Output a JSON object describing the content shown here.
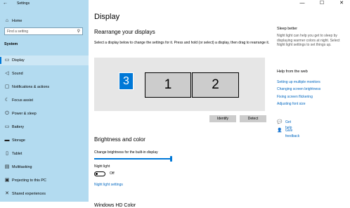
{
  "window": {
    "title": "Settings",
    "back_glyph": "←",
    "controls": {
      "minimize": "—",
      "maximize": "☐",
      "close": "✕"
    }
  },
  "sidebar": {
    "home_label": "Home",
    "search_placeholder": "Find a setting",
    "section_title": "System",
    "items": [
      {
        "label": "Display",
        "icon": "monitor-icon",
        "selected": true
      },
      {
        "label": "Sound",
        "icon": "speaker-icon"
      },
      {
        "label": "Notifications & actions",
        "icon": "notification-icon"
      },
      {
        "label": "Focus assist",
        "icon": "moon-icon"
      },
      {
        "label": "Power & sleep",
        "icon": "power-icon"
      },
      {
        "label": "Battery",
        "icon": "battery-icon"
      },
      {
        "label": "Storage",
        "icon": "storage-icon"
      },
      {
        "label": "Tablet",
        "icon": "tablet-icon"
      },
      {
        "label": "Multitasking",
        "icon": "multitasking-icon"
      },
      {
        "label": "Projecting to this PC",
        "icon": "projecting-icon"
      },
      {
        "label": "Shared experiences",
        "icon": "shared-icon"
      }
    ]
  },
  "main": {
    "title": "Display",
    "rearrange": {
      "heading": "Rearrange your displays",
      "description": "Select a display below to change the settings for it. Press and hold (or select) a display, then drag to rearrange it.",
      "monitors": [
        {
          "number": "3",
          "selected": true
        },
        {
          "number": "1",
          "selected": false
        },
        {
          "number": "2",
          "selected": false
        }
      ],
      "identify_label": "Identify",
      "detect_label": "Detect"
    },
    "brightness": {
      "heading": "Brightness and color",
      "slider_label": "Change brightness for the built-in display",
      "level_percent": 100
    },
    "night_light": {
      "label": "Night light",
      "state": "Off",
      "settings_link": "Night light settings"
    },
    "next_heading": "Windows HD Color"
  },
  "right_panel": {
    "sleep_title": "Sleep better",
    "sleep_text": "Night light can help you get to sleep by displaying warmer colors at night. Select Night light settings to set things up.",
    "help_title": "Help from the web",
    "help_links": [
      "Setting up multiple monitors",
      "Changing screen brightness",
      "Fixing screen flickering",
      "Adjusting font size"
    ],
    "get_help": "Get help",
    "give_feedback": "Give feedback"
  },
  "colors": {
    "sidebar_bg": "#b3dbf0",
    "accent": "#0078d7",
    "link": "#0067c0"
  }
}
